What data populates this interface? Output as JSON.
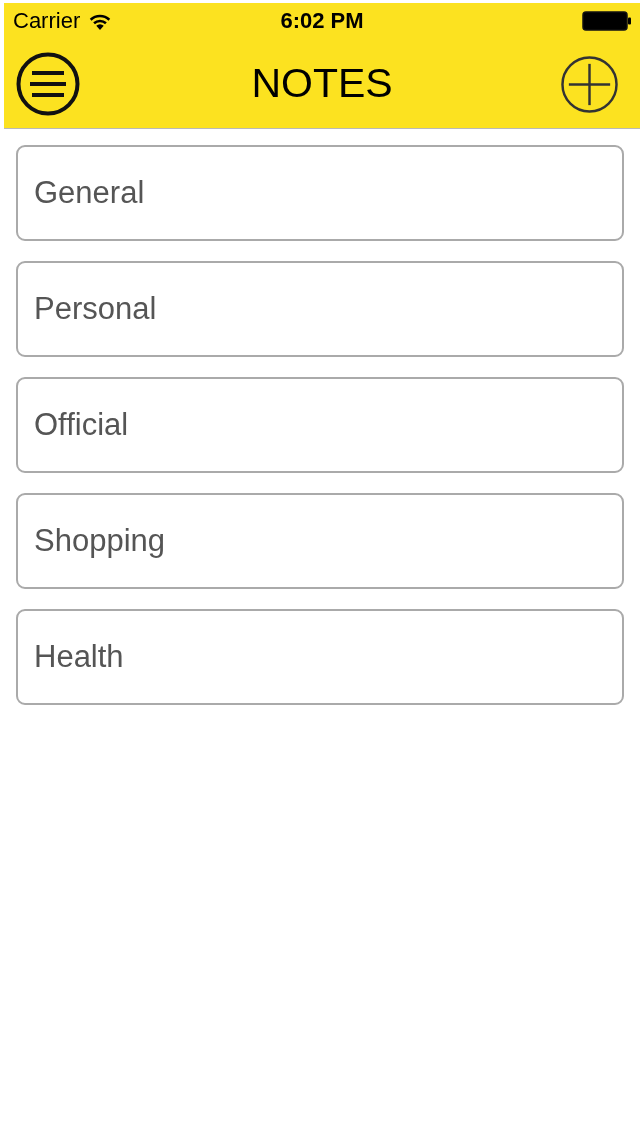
{
  "status_bar": {
    "carrier": "Carrier",
    "time": "6:02 PM"
  },
  "header": {
    "title": "NOTES"
  },
  "categories": [
    {
      "label": "General"
    },
    {
      "label": "Personal"
    },
    {
      "label": "Official"
    },
    {
      "label": "Shopping"
    },
    {
      "label": "Health"
    }
  ]
}
